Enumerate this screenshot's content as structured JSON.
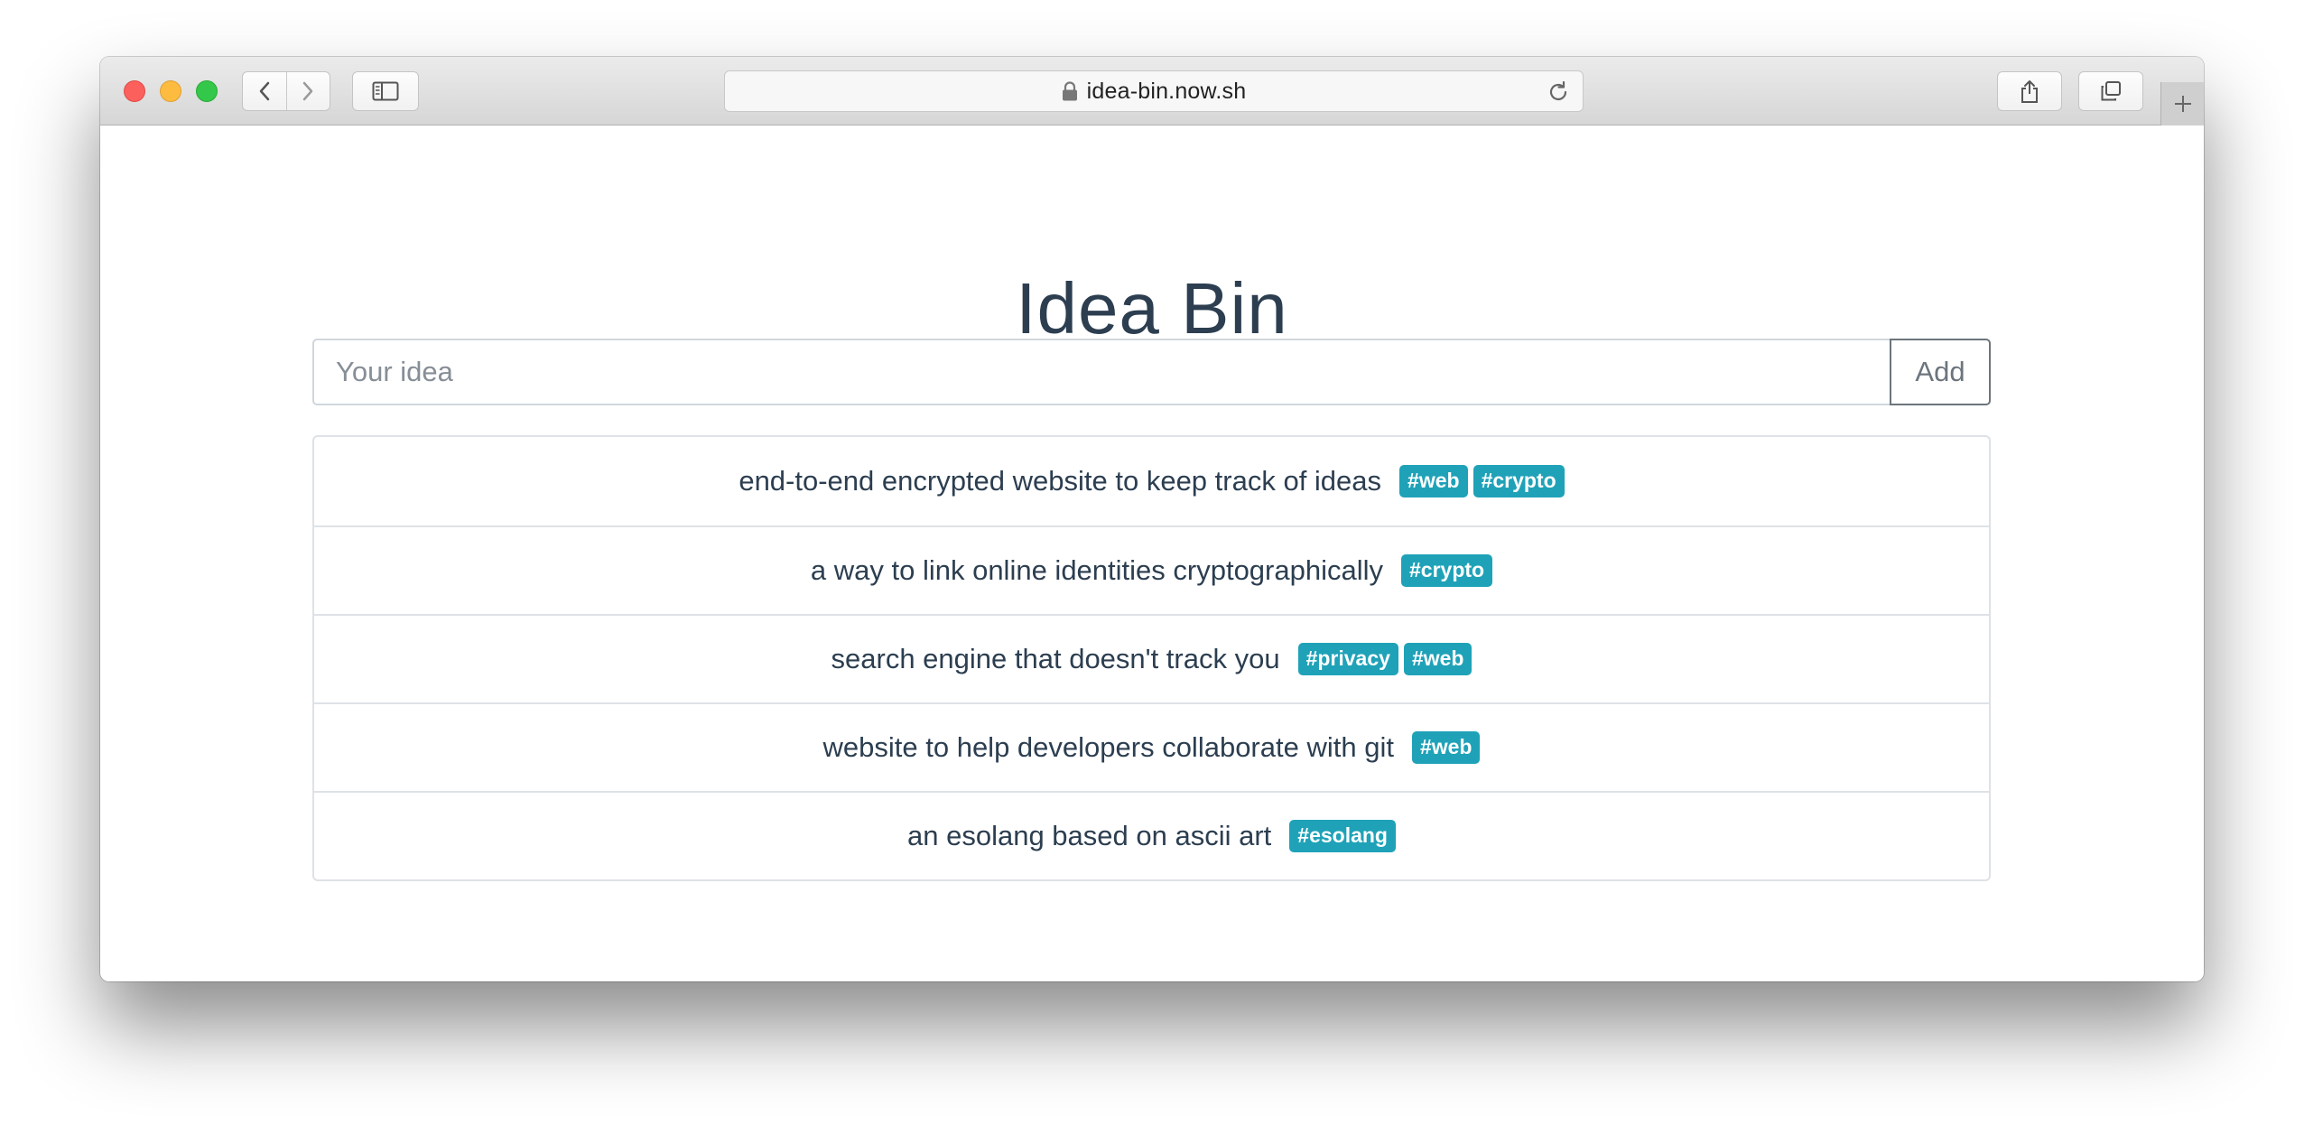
{
  "browser": {
    "url": "idea-bin.now.sh",
    "icons": {
      "back": "chevron-left-icon",
      "forward": "chevron-right-icon",
      "sidebar": "sidebar-icon",
      "lock": "lock-icon",
      "reload": "reload-icon",
      "share": "share-icon",
      "tabs": "tabs-overview-icon",
      "new_tab": "plus-icon"
    }
  },
  "page": {
    "title": "Idea Bin",
    "input": {
      "placeholder": "Your idea",
      "value": ""
    },
    "add_label": "Add",
    "ideas": [
      {
        "text": "end-to-end encrypted website to keep track of ideas",
        "tags": [
          "#web",
          "#crypto"
        ]
      },
      {
        "text": "a way to link online identities cryptographically",
        "tags": [
          "#crypto"
        ]
      },
      {
        "text": "search engine that doesn't track you",
        "tags": [
          "#privacy",
          "#web"
        ]
      },
      {
        "text": "website to help developers collaborate with git",
        "tags": [
          "#web"
        ]
      },
      {
        "text": "an esolang based on ascii art",
        "tags": [
          "#esolang"
        ]
      }
    ]
  },
  "colors": {
    "title": "#2c3e50",
    "tag_background": "#1fa2b8",
    "tag_text": "#ffffff",
    "button_outline": "#6c757d"
  }
}
